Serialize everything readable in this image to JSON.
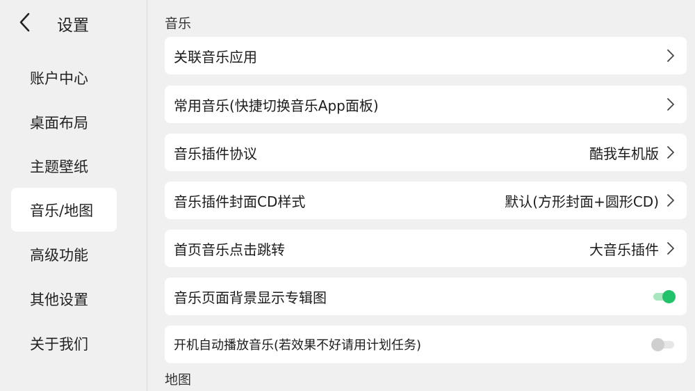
{
  "sidebar": {
    "title": "设置",
    "items": [
      {
        "label": "账户中心",
        "active": false
      },
      {
        "label": "桌面布局",
        "active": false
      },
      {
        "label": "主题壁纸",
        "active": false
      },
      {
        "label": "音乐/地图",
        "active": true
      },
      {
        "label": "高级功能",
        "active": false
      },
      {
        "label": "其他设置",
        "active": false
      },
      {
        "label": "关于我们",
        "active": false
      }
    ]
  },
  "main": {
    "music_section_title": "音乐",
    "map_section_title": "地图",
    "rows": [
      {
        "label": "关联音乐应用",
        "value": ""
      },
      {
        "label": "常用音乐(快捷切换音乐App面板)",
        "value": ""
      },
      {
        "label": "音乐插件协议",
        "value": "酷我车机版"
      },
      {
        "label": "音乐插件封面CD样式",
        "value": "默认(方形封面+圆形CD)"
      },
      {
        "label": "首页音乐点击跳转",
        "value": "大音乐插件"
      },
      {
        "label": "音乐页面背景显示专辑图",
        "toggle": true
      },
      {
        "label": "开机自动播放音乐(若效果不好请用计划任务)",
        "toggle": false
      }
    ]
  },
  "colors": {
    "accent": "#22c26a",
    "background": "#f0f0f0",
    "card": "#ffffff"
  },
  "icons": {
    "back": "chevron-left-icon",
    "row_arrow": "chevron-right-icon"
  }
}
